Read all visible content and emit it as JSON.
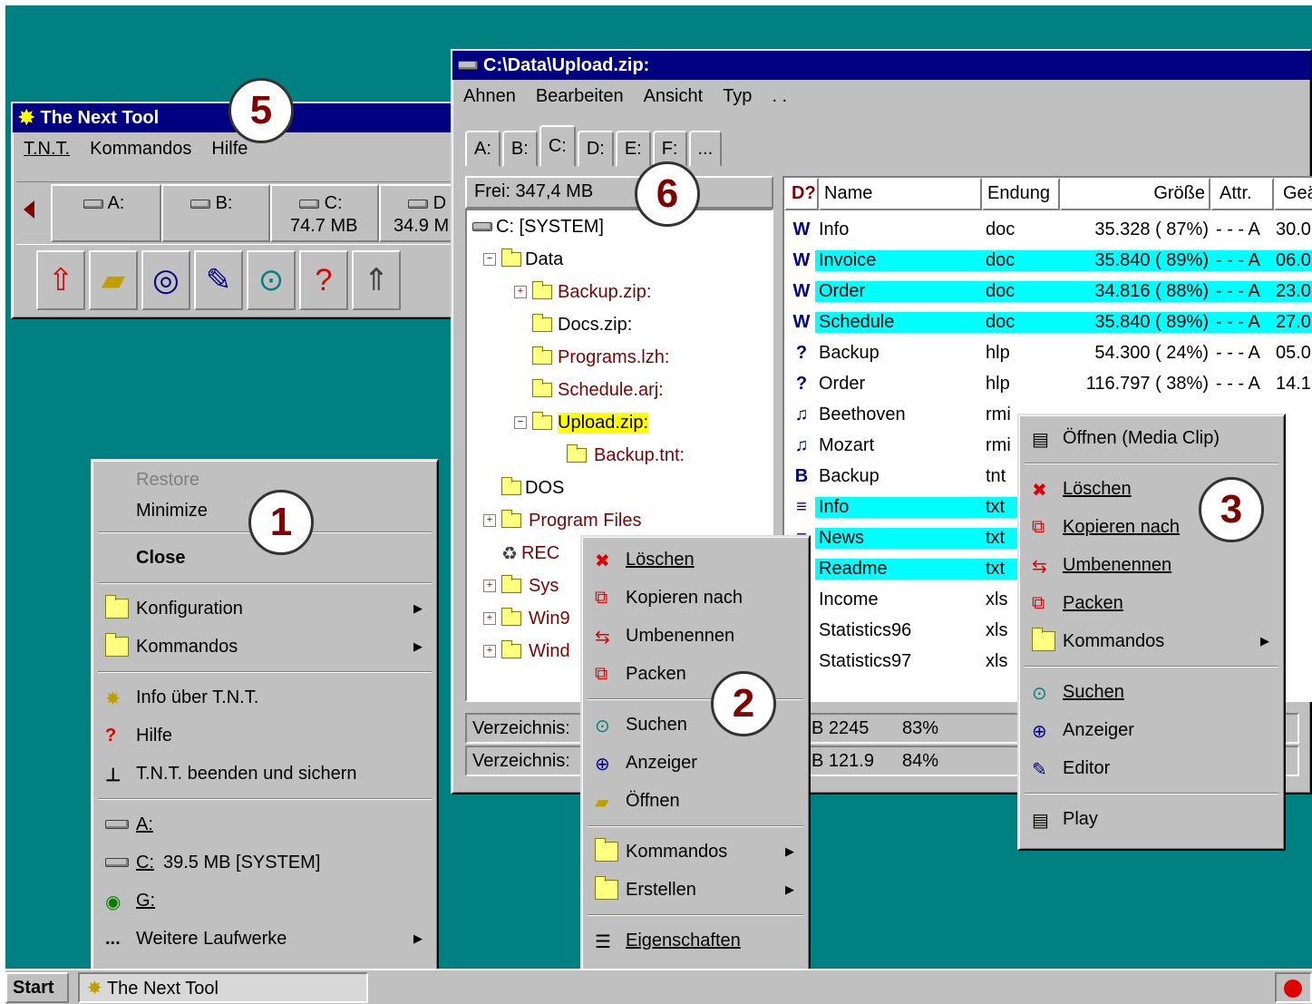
{
  "tnt_window": {
    "title": "The Next Tool",
    "menu": [
      "T.N.T.",
      "Kommandos",
      "Hilfe"
    ],
    "drives": [
      {
        "label": "A:",
        "size": ""
      },
      {
        "label": "B:",
        "size": ""
      },
      {
        "label": "C:",
        "size": "74.7 MB"
      },
      {
        "label": "D",
        "size": "34.9 M"
      }
    ]
  },
  "explorer": {
    "title": "C:\\Data\\Upload.zip:",
    "menu": [
      "Ahnen",
      "Bearbeiten",
      "Ansicht",
      "Typ",
      ". ."
    ],
    "tabs": [
      "A:",
      "B:",
      "C:",
      "D:",
      "E:",
      "F:",
      "..."
    ],
    "free": "Frei: 347,4 MB",
    "tree": [
      {
        "label": "C: [SYSTEM]",
        "type": "drive",
        "color": "#000000",
        "highlight": false
      },
      {
        "label": "Data",
        "type": "folder",
        "color": "#000000",
        "highlight": false
      },
      {
        "label": "Backup.zip:",
        "type": "zip",
        "color": "#800000",
        "highlight": false
      },
      {
        "label": "Docs.zip:",
        "type": "zip",
        "color": "#000000",
        "highlight": false
      },
      {
        "label": "Programs.lzh:",
        "type": "zip",
        "color": "#800000",
        "highlight": false
      },
      {
        "label": "Schedule.arj:",
        "type": "zip",
        "color": "#800000",
        "highlight": false
      },
      {
        "label": "Upload.zip:",
        "type": "zip",
        "color": "#000000",
        "highlight": true
      },
      {
        "label": "Backup.tnt:",
        "type": "tnt",
        "color": "#800000",
        "highlight": false
      },
      {
        "label": "DOS",
        "type": "folder",
        "color": "#000000",
        "highlight": false
      },
      {
        "label": "Program Files",
        "type": "folder",
        "color": "#800000",
        "highlight": false
      },
      {
        "label": "REC",
        "type": "recycle",
        "color": "#800000",
        "highlight": false
      },
      {
        "label": "Sys",
        "type": "folder",
        "color": "#800000",
        "highlight": false
      },
      {
        "label": "Win9",
        "type": "folder",
        "color": "#800000",
        "highlight": false
      },
      {
        "label": "Wind",
        "type": "folder",
        "color": "#800000",
        "highlight": false
      }
    ],
    "columns": [
      "Name",
      "Endung",
      "Größe",
      "Attr.",
      "Geä"
    ],
    "files": [
      {
        "name": "Info",
        "ext": "doc",
        "size": "35.328 ( 87%)",
        "attr": "- - - A",
        "date": "30.0",
        "hl": false,
        "icon": "W"
      },
      {
        "name": "Invoice",
        "ext": "doc",
        "size": "35.840 ( 89%)",
        "attr": "- - - A",
        "date": "06.0",
        "hl": true,
        "icon": "W"
      },
      {
        "name": "Order",
        "ext": "doc",
        "size": "34.816 ( 88%)",
        "attr": "- - - A",
        "date": "23.0",
        "hl": true,
        "icon": "W"
      },
      {
        "name": "Schedule",
        "ext": "doc",
        "size": "35.840 ( 89%)",
        "attr": "- - - A",
        "date": "27.0",
        "hl": true,
        "icon": "W"
      },
      {
        "name": "Backup",
        "ext": "hlp",
        "size": "54.300 ( 24%)",
        "attr": "- - - A",
        "date": "05.0",
        "hl": false,
        "icon": "?"
      },
      {
        "name": "Order",
        "ext": "hlp",
        "size": "116.797 ( 38%)",
        "attr": "- - - A",
        "date": "14.1",
        "hl": false,
        "icon": "?"
      },
      {
        "name": "Beethoven",
        "ext": "rmi",
        "size": "",
        "attr": "",
        "date": "",
        "hl": false,
        "icon": "♫"
      },
      {
        "name": "Mozart",
        "ext": "rmi",
        "size": "",
        "attr": "",
        "date": "",
        "hl": false,
        "icon": "♫"
      },
      {
        "name": "Backup",
        "ext": "tnt",
        "size": "",
        "attr": "",
        "date": "",
        "hl": false,
        "icon": "B"
      },
      {
        "name": "Info",
        "ext": "txt",
        "size": "",
        "attr": "",
        "date": "",
        "hl": true,
        "icon": "≡"
      },
      {
        "name": "News",
        "ext": "txt",
        "size": "",
        "attr": "",
        "date": "",
        "hl": true,
        "icon": "≡"
      },
      {
        "name": "Readme",
        "ext": "txt",
        "size": "",
        "attr": "",
        "date": "",
        "hl": true,
        "icon": ""
      },
      {
        "name": "Income",
        "ext": "xls",
        "size": "",
        "attr": "",
        "date": "",
        "hl": false,
        "icon": ""
      },
      {
        "name": "Statistics96",
        "ext": "xls",
        "size": "",
        "attr": "",
        "date": "",
        "hl": false,
        "icon": ""
      },
      {
        "name": "Statistics97",
        "ext": "xls",
        "size": "",
        "attr": "",
        "date": "",
        "hl": false,
        "icon": ""
      }
    ],
    "status": [
      {
        "label": "Verzeichnis:",
        "size": "B 2245",
        "pct": "83%"
      },
      {
        "label": "Verzeichnis:",
        "size": "B 121.9",
        "pct": "84%"
      }
    ]
  },
  "menu1": {
    "restore": "Restore",
    "minimize": "Minimize",
    "close": "Close",
    "konfiguration": "Konfiguration",
    "kommandos": "Kommandos",
    "info": "Info über T.N.T.",
    "hilfe": "Hilfe",
    "beenden": "T.N.T. beenden und sichern",
    "drive_a": "A:",
    "drive_c": "C:",
    "drive_c_info": "39.5 MB [SYSTEM]",
    "drive_g": "G:",
    "more_dots": "...",
    "more": "Weitere Laufwerke"
  },
  "menu2": {
    "loeschen": "Löschen",
    "kopieren": "Kopieren nach",
    "umbenennen": "Umbenennen",
    "packen": "Packen",
    "suchen": "Suchen",
    "anzeiger": "Anzeiger",
    "oeffnen": "Öffnen",
    "kommandos": "Kommandos",
    "erstellen": "Erstellen",
    "eigenschaften": "Eigenschaften"
  },
  "menu3": {
    "oeffnen_media": "Öffnen (Media Clip)",
    "loeschen": "Löschen",
    "kopieren": "Kopieren nach",
    "umbenennen": "Umbenennen",
    "packen": "Packen",
    "kommandos": "Kommandos",
    "suchen": "Suchen",
    "anzeiger": "Anzeiger",
    "editor": "Editor",
    "play": "Play"
  },
  "callouts": [
    "5",
    "6",
    "1",
    "2",
    "3"
  ],
  "taskbar": {
    "start": "Start",
    "task": "The Next Tool"
  },
  "colors": {
    "desktop": "#008080",
    "titlebar": "#000080",
    "selection": "#00ffff",
    "archive_red": "#800000",
    "highlight_yellow": "#ffff00"
  }
}
